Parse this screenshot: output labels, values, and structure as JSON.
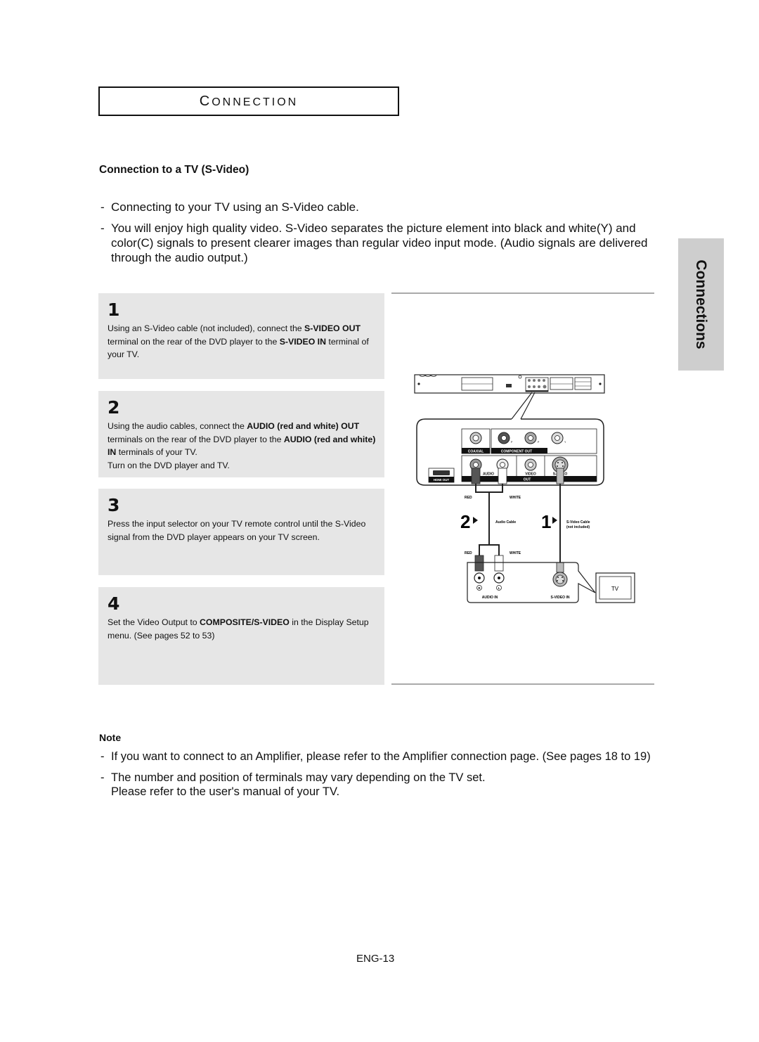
{
  "section": {
    "title_first": "C",
    "title_rest": "ONNECTION"
  },
  "subtitle": "Connection to a TV (S-Video)",
  "side_tab": "Connections",
  "intro": [
    "Connecting to your TV using an S-Video cable.",
    "You will enjoy high quality video. S-Video separates the picture element into black and white(Y) and color(C) signals to present clearer images than regular video input mode. (Audio signals are delivered through the audio output.)"
  ],
  "steps": [
    {
      "number": "1",
      "segments": [
        {
          "text": "Using an S-Video cable (not included), connect the ",
          "bold": false
        },
        {
          "text": "S-VIDEO OUT",
          "bold": true
        },
        {
          "text": " terminal on the rear of the DVD player to the ",
          "bold": false
        },
        {
          "text": "S-VIDEO IN",
          "bold": true
        },
        {
          "text": " terminal of your TV.",
          "bold": false
        }
      ]
    },
    {
      "number": "2",
      "segments": [
        {
          "text": "Using the audio cables, connect the ",
          "bold": false
        },
        {
          "text": "AUDIO (red and white) OUT",
          "bold": true
        },
        {
          "text": " terminals on the rear of the DVD player to the ",
          "bold": false
        },
        {
          "text": "AUDIO (red and white) IN",
          "bold": true
        },
        {
          "text": " terminals of your TV.",
          "bold": false
        }
      ],
      "extra_line": "Turn on the DVD player and TV."
    },
    {
      "number": "3",
      "segments": [
        {
          "text": "Press the input selector on your TV remote control until the S-Video signal from the DVD player appears on your TV screen.",
          "bold": false
        }
      ]
    },
    {
      "number": "4",
      "segments": [
        {
          "text": "Set the Video Output to ",
          "bold": false
        },
        {
          "text": "COMPOSITE/S-VIDEO",
          "bold": true
        },
        {
          "text": " in the Display Setup menu. (See pages 52 to 53)",
          "bold": false
        }
      ]
    }
  ],
  "diagram": {
    "player_labels": {
      "coaxial": "COAXIAL",
      "component_out": "COMPONENT OUT",
      "hdmi_out": "HDMI OUT",
      "audio": "AUDIO",
      "video": "VIDEO",
      "s_video": "S-VIDEO",
      "out": "OUT",
      "pr": "P",
      "pb": "P",
      "y": "Y"
    },
    "cable_labels": {
      "red_top": "RED",
      "white_top": "WHITE",
      "red_bottom": "RED",
      "white_bottom": "WHITE",
      "audio_cable": "Audio Cable",
      "svideo_cable": "S-Video Cable",
      "svideo_cable_note": "(not included)",
      "step_audio": "2",
      "step_svideo": "1"
    },
    "tv_labels": {
      "r": "R",
      "l": "L",
      "audio_in": "AUDIO IN",
      "s_video_in": "S-VIDEO IN",
      "tv": "TV"
    },
    "colors": {
      "red_plug": "#555555",
      "white_plug": "#ffffff",
      "svideo_plug": "#bbbbbb"
    }
  },
  "note": {
    "title": "Note",
    "items": [
      "If you want to connect to an Amplifier, please refer to the Amplifier connection page. (See pages 18 to 19)",
      "The number and position of terminals may vary depending on the TV set.\nPlease refer to the user's manual of your TV."
    ]
  },
  "page_number": "ENG-13"
}
